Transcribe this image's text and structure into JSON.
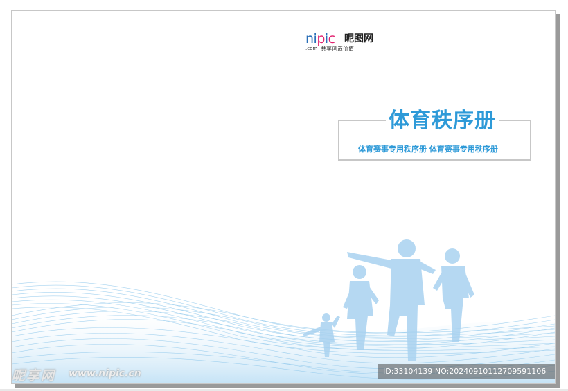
{
  "logo": {
    "word": [
      "n",
      "i",
      "p",
      "i",
      "c"
    ],
    "name_cn": "昵图网",
    "com": ".com",
    "slogan": "共享创造价值"
  },
  "cover": {
    "title": "体育秩序册",
    "subtitle": "体育赛事专用秩序册 体育赛事专用秩序册"
  },
  "watermark": {
    "brand": "昵享网",
    "url": "www.nipic.cn",
    "id_text": "ID:33104139 NO:20240910112709591106"
  },
  "colors": {
    "title_blue": "#2e9ad8",
    "wave_blue": "#8fc8ec",
    "silhouette_blue": "#a9d2f0",
    "logo_blue": "#2a6fb8",
    "logo_pink": "#e2226f"
  }
}
